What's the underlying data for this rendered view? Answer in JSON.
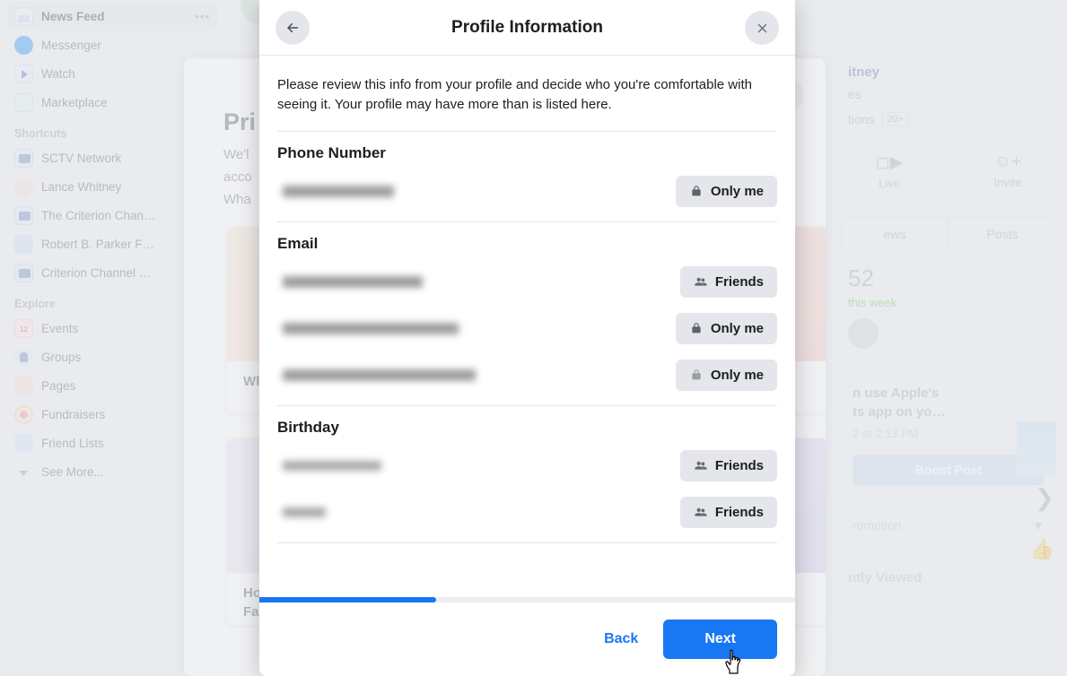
{
  "background": {
    "sidebar": {
      "items": [
        {
          "label": "News Feed",
          "icon": "news-feed-icon",
          "trailing": "•••",
          "active": true
        },
        {
          "label": "Messenger",
          "icon": "messenger-icon",
          "trailing": ""
        },
        {
          "label": "Watch",
          "icon": "watch-icon",
          "trailing": ""
        },
        {
          "label": "Marketplace",
          "icon": "marketplace-icon",
          "trailing": ""
        }
      ],
      "shortcuts_heading": "Shortcuts",
      "shortcuts": [
        {
          "label": "SCTV Network",
          "icon": "group-icon"
        },
        {
          "label": "Lance Whitney",
          "icon": "avatar-icon"
        },
        {
          "label": "The Criterion Chan…",
          "icon": "group-icon"
        },
        {
          "label": "Robert B. Parker F…",
          "icon": "book-icon"
        },
        {
          "label": "Criterion Channel …",
          "icon": "group-icon"
        }
      ],
      "explore_heading": "Explore",
      "explore": [
        {
          "label": "Events",
          "icon": "calendar-icon"
        },
        {
          "label": "Groups",
          "icon": "groups-icon"
        },
        {
          "label": "Pages",
          "icon": "flag-icon"
        },
        {
          "label": "Fundraisers",
          "icon": "fundraiser-icon"
        },
        {
          "label": "Friend Lists",
          "icon": "friend-lists-icon"
        },
        {
          "label": "See More...",
          "icon": "chevron-down-icon"
        }
      ]
    },
    "dialog": {
      "title": "Pri",
      "sub_line_1": "We'l",
      "sub_line_2": "acco",
      "sub_line_3": "Wha",
      "card_1_caption": "Wh",
      "card_2_caption_line_1": "Ho",
      "card_2_caption_line_2": "Fa",
      "close_icon": "close-icon"
    },
    "right_panel": {
      "page_name": "itney",
      "page_sub": "es",
      "notifications_label": "tions",
      "notifications_badge": "20+",
      "actions": [
        {
          "label": "Live",
          "icon": "live-video-icon"
        },
        {
          "label": "Invite",
          "icon": "invite-person-icon"
        }
      ],
      "tabs": [
        "ews",
        "Posts"
      ],
      "stat_number": "52",
      "stat_note": "this week",
      "post_title_line_1": "n use Apple's",
      "post_title_line_2": "ts app on yo…",
      "post_date": "2 at 2:13 PM",
      "boost_label": "Boost Post",
      "promotion_label": "romotion",
      "recently_viewed": "ntly Viewed"
    }
  },
  "modal": {
    "header": {
      "title": "Profile Information",
      "back_icon": "arrow-left-icon",
      "close_icon": "close-icon"
    },
    "intro": "Please review this info from your profile and decide who you're comfortable with seeing it. Your profile may have more than is listed here.",
    "sections": [
      {
        "title": "Phone Number",
        "rows": [
          {
            "value_redacted": true,
            "value_width": "r-phone",
            "audience": "Only me",
            "audience_icon": "lock-icon"
          }
        ]
      },
      {
        "title": "Email",
        "rows": [
          {
            "value_redacted": true,
            "value_width": "r-e1",
            "audience": "Friends",
            "audience_icon": "friends-icon"
          },
          {
            "value_redacted": true,
            "value_width": "r-e2",
            "audience": "Only me",
            "audience_icon": "lock-icon"
          },
          {
            "value_redacted": true,
            "value_width": "r-e3",
            "audience": "Only me",
            "audience_icon": "lock-open-icon"
          }
        ]
      },
      {
        "title": "Birthday",
        "rows": [
          {
            "value_redacted": true,
            "value_width": "r-b1",
            "audience": "Friends",
            "audience_icon": "friends-icon"
          },
          {
            "value_redacted": true,
            "value_width": "r-b2",
            "audience": "Friends",
            "audience_icon": "friends-icon"
          }
        ]
      }
    ],
    "progress_percent": 33,
    "footer": {
      "back_label": "Back",
      "next_label": "Next"
    }
  },
  "colors": {
    "accent": "#1877f2",
    "button_bg": "#e4e6eb",
    "page_bg": "#e9ebee",
    "text": "#1c1e21"
  }
}
